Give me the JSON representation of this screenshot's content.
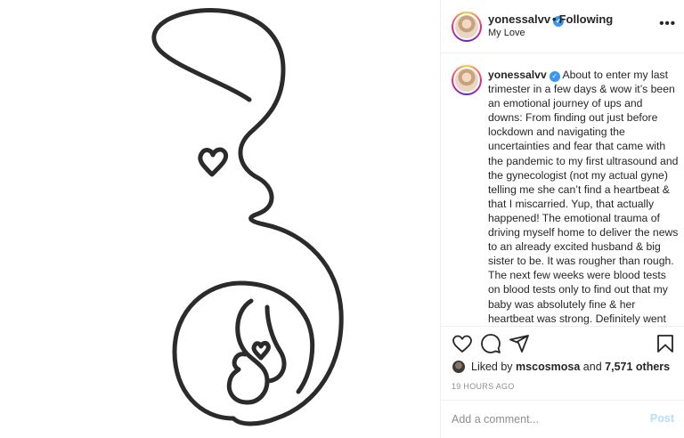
{
  "post": {
    "username": "yonessalvv",
    "verified_mark": "✓",
    "separator": "•",
    "follow_status": "Following",
    "location": "My Love",
    "more_label": "•••"
  },
  "caption": {
    "username": "yonessalvv",
    "text": "About to enter my last trimester in a few days & wow it’s been an emotional journey of ups and downs: From finding out just before lockdown and navigating the uncertainties and fear that came with the pandemic to my first ultrasound and the gynecologist (not my actual gyne) telling me she can’t find a heartbeat & that I miscarried. Yup, that actually happened! The emotional trauma of driving myself home to deliver the news to an already excited husband & big sister to be. It was rougher than rough. The next few weeks were blood tests on blood tests only to find out that my baby was absolutely fine & her heartbeat was strong. Definitely went back to my original gynecologist & everytime I think of how far we’ve come"
  },
  "actions": {
    "icons": [
      "heart-icon",
      "comment-icon",
      "share-icon",
      "bookmark-icon"
    ]
  },
  "likes": {
    "prefix": "Liked by",
    "user": "mscosmosa",
    "and": "and",
    "others": "7,571 others"
  },
  "timestamp": "19 HOURS AGO",
  "comment": {
    "placeholder": "Add a comment...",
    "post_label": "Post"
  },
  "colors": {
    "verified": "#3897f0",
    "post_disabled": "#b2dffc",
    "muted": "#8e8e8e",
    "line_art": "#2b2b2b"
  }
}
